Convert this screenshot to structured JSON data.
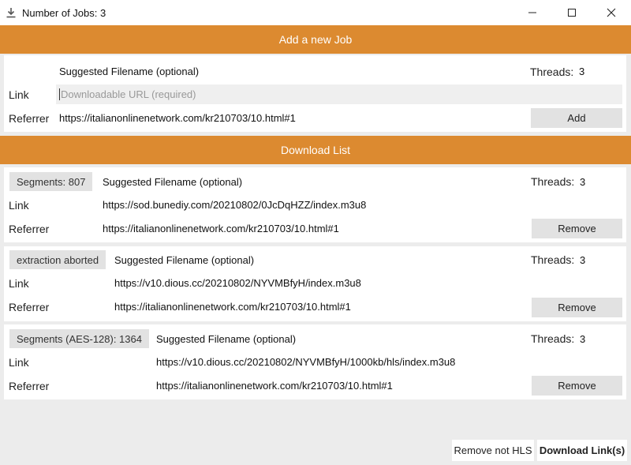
{
  "window": {
    "title": "Number of Jobs: 3"
  },
  "add_job": {
    "header": "Add a new Job",
    "filename_placeholder": "Suggested Filename (optional)",
    "threads_label": "Threads:",
    "threads_value": "3",
    "link_label": "Link",
    "link_placeholder": "Downloadable URL (required)",
    "referrer_label": "Referrer",
    "referrer_value": "https://italianonlinenetwork.com/kr210703/10.html#1",
    "add_label": "Add"
  },
  "download_list": {
    "header": "Download List",
    "jobs": [
      {
        "status": "Segments: 807",
        "filename_placeholder": "Suggested Filename (optional)",
        "threads_label": "Threads:",
        "threads_value": "3",
        "link_label": "Link",
        "link": "https://sod.bunediy.com/20210802/0JcDqHZZ/index.m3u8",
        "referrer_label": "Referrer",
        "referrer": "https://italianonlinenetwork.com/kr210703/10.html#1",
        "remove_label": "Remove"
      },
      {
        "status": "extraction aborted",
        "filename_placeholder": "Suggested Filename (optional)",
        "threads_label": "Threads:",
        "threads_value": "3",
        "link_label": "Link",
        "link": "https://v10.dious.cc/20210802/NYVMBfyH/index.m3u8",
        "referrer_label": "Referrer",
        "referrer": "https://italianonlinenetwork.com/kr210703/10.html#1",
        "remove_label": "Remove"
      },
      {
        "status": "Segments (AES-128): 1364",
        "filename_placeholder": "Suggested Filename (optional)",
        "threads_label": "Threads:",
        "threads_value": "3",
        "link_label": "Link",
        "link": "https://v10.dious.cc/20210802/NYVMBfyH/1000kb/hls/index.m3u8",
        "referrer_label": "Referrer",
        "referrer": "https://italianonlinenetwork.com/kr210703/10.html#1",
        "remove_label": "Remove"
      }
    ]
  },
  "footer": {
    "remove_not_hls_label": "Remove not HLS",
    "download_links_label": "Download Link(s)"
  },
  "icons": {
    "title": "download-icon",
    "minimize": "minimize-icon",
    "maximize": "maximize-icon",
    "close": "close-icon"
  },
  "colors": {
    "accent": "#dc8a30",
    "background": "#ececec",
    "button": "#e2e2e2"
  }
}
